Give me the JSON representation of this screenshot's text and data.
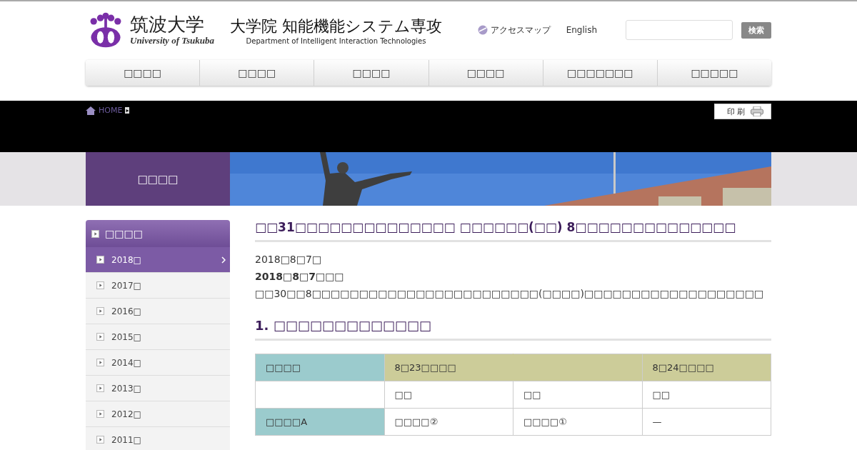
{
  "header": {
    "logo_jp": "筑波大学",
    "logo_en": "University of Tsukuba",
    "site_title": "大学院 知能機能システム専攻",
    "site_subtitle": "Department of Intelligent Interaction Technologies",
    "links": [
      "アクセスマップ",
      "English"
    ],
    "search_button": "検索"
  },
  "nav": [
    "□□□□",
    "□□□□",
    "□□□□",
    "□□□□",
    "□□□□□□□",
    "□□□□□"
  ],
  "breadcrumb": {
    "home": "HOME",
    "separator": "▸"
  },
  "print_button": "印 刷",
  "banner": {
    "title": "□□□□",
    "kind": "picture"
  },
  "sidebar": {
    "title": "□□□□",
    "items": [
      {
        "label": "2018□",
        "selected": true
      },
      {
        "label": "2017□",
        "selected": false
      },
      {
        "label": "2016□",
        "selected": false
      },
      {
        "label": "2015□",
        "selected": false
      },
      {
        "label": "2014□",
        "selected": false
      },
      {
        "label": "2013□",
        "selected": false
      },
      {
        "label": "2012□",
        "selected": false
      },
      {
        "label": "2011□",
        "selected": false
      }
    ]
  },
  "article": {
    "title": "□□31□□□□□□□□□□□□□□ □□□□□□(□□) 8□□□□□□□□□□□□□□",
    "date": "2018□8□7□",
    "lead": "2018□8□7□□□",
    "body": "□□30□□8□□□□□□□□□□□□□□□□□□□□□□□□(□□□□)□□□□□□□□□□□□□□□□□□□",
    "section": "1. □□□□□□□□□□□□□"
  },
  "table": {
    "rows": [
      {
        "kind": "head",
        "cells": [
          "□□□□",
          "8□23□□□□",
          "",
          "8□24□□□□"
        ]
      },
      {
        "kind": "sub",
        "cells": [
          "",
          "□□",
          "□□",
          "□□"
        ]
      },
      {
        "kind": "body",
        "cells": [
          "□□□□A",
          "□□□□②",
          "□□□□①",
          "—"
        ]
      }
    ]
  }
}
